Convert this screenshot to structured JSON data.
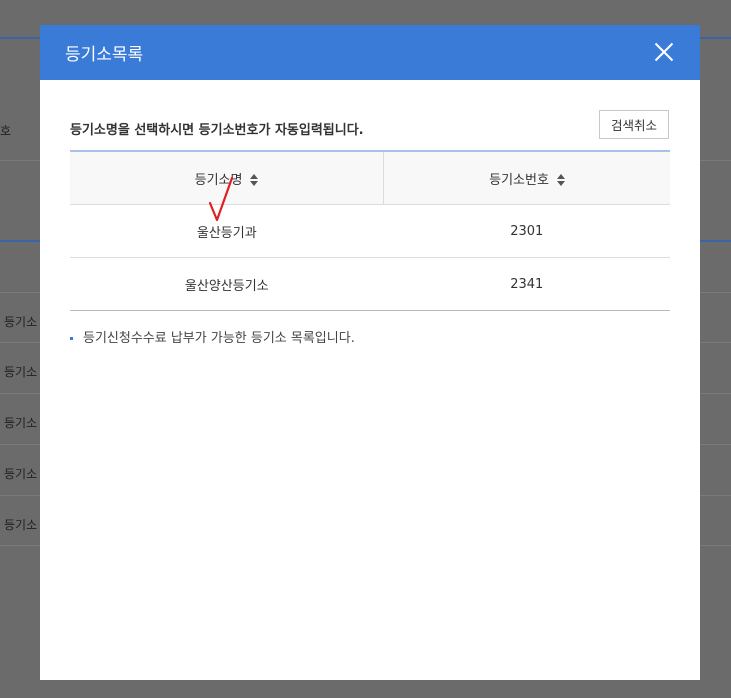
{
  "background": {
    "row_label_fragment": "호",
    "list_items": [
      "등기소",
      "등기소",
      "등기소",
      "등기소",
      "등기소"
    ]
  },
  "modal": {
    "title": "등기소목록",
    "description": "등기소명을 선택하시면 등기소번호가 자동입력됩니다.",
    "cancel_label": "검색취소",
    "columns": [
      "등기소명",
      "등기소번호"
    ],
    "rows": [
      {
        "name": "울산등기과",
        "code": "2301"
      },
      {
        "name": "울산양산등기소",
        "code": "2341"
      }
    ],
    "note": "등기신청수수료 납부가 가능한 등기소 목록입니다."
  },
  "colors": {
    "header": "#3b7bd8",
    "annotation": "#e02020"
  }
}
